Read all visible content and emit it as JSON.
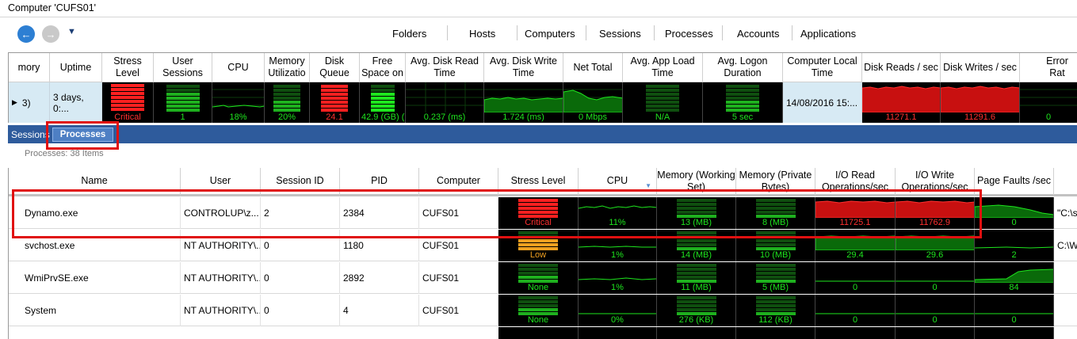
{
  "window": {
    "title": "Computer 'CUFS01'"
  },
  "nav": {
    "links": [
      "Folders",
      "Hosts",
      "Computers",
      "Sessions",
      "Processes",
      "Accounts",
      "Applications"
    ]
  },
  "summary": {
    "headers": [
      "mory",
      "Uptime",
      "Stress Level",
      "User Sessions",
      "CPU",
      "Memory Utilizatio",
      "Disk Queue",
      "Free Space on",
      "Avg. Disk Read Time",
      "Avg. Disk Write Time",
      "Net Total",
      "Avg. App Load Time",
      "Avg. Logon Duration",
      "Computer Local Time",
      "Disk Reads / sec",
      "Disk Writes / sec",
      "Error Rat"
    ],
    "first_cell": "3)",
    "uptime": "3 days, 0:...",
    "stress": "Critical",
    "user_sessions": "1",
    "cpu": "18%",
    "memory": "20%",
    "disk_queue": "24.1",
    "free_space": "42.9 (GB) (",
    "avg_disk_read": "0.237 (ms)",
    "avg_disk_write": "1.724 (ms)",
    "net_total": "0 Mbps",
    "avg_app_load": "N/A",
    "avg_logon": "5 sec",
    "local_time": "14/08/2016 15:...",
    "disk_reads": "11271.1",
    "disk_writes": "11291.6",
    "error_rate": "0"
  },
  "tabs": {
    "sessions": "Sessions",
    "processes": "Processes"
  },
  "processes_count": "Processes: 38 Items",
  "columns": [
    "Name",
    "User",
    "Session ID",
    "PID",
    "Computer",
    "Stress Level",
    "CPU",
    "Memory (Working Set)",
    "Memory (Private Bytes)",
    "I/O Read Operations/sec",
    "I/O Write Operations/sec",
    "Page Faults /sec"
  ],
  "rows": [
    {
      "name": "Dynamo.exe",
      "user": "CONTROLUP\\z...",
      "session": "2",
      "pid": "2384",
      "computer": "CUFS01",
      "stress": "Critical",
      "cpu": "11%",
      "mem_ws": "13 (MB)",
      "mem_pb": "8 (MB)",
      "io_read": "11725.1",
      "io_write": "11762.9",
      "page_faults": "0",
      "extra": "\"C:\\s"
    },
    {
      "name": "svchost.exe",
      "user": "NT AUTHORITY\\...",
      "session": "0",
      "pid": "1180",
      "computer": "CUFS01",
      "stress": "Low",
      "cpu": "1%",
      "mem_ws": "14 (MB)",
      "mem_pb": "10 (MB)",
      "io_read": "29.4",
      "io_write": "29.6",
      "page_faults": "2",
      "extra": "C:\\W"
    },
    {
      "name": "WmiPrvSE.exe",
      "user": "NT AUTHORITY\\...",
      "session": "0",
      "pid": "2892",
      "computer": "CUFS01",
      "stress": "None",
      "cpu": "1%",
      "mem_ws": "11 (MB)",
      "mem_pb": "5 (MB)",
      "io_read": "0",
      "io_write": "0",
      "page_faults": "84",
      "extra": ""
    },
    {
      "name": "System",
      "user": "NT AUTHORITY\\...",
      "session": "0",
      "pid": "4",
      "computer": "CUFS01",
      "stress": "None",
      "cpu": "0%",
      "mem_ws": "276 (KB)",
      "mem_pb": "112 (KB)",
      "io_read": "0",
      "io_write": "0",
      "page_faults": "0",
      "extra": ""
    }
  ],
  "colors": {
    "critical": "#ff2020",
    "low": "#f0a020",
    "none": "#1ee61e",
    "tab_strip": "#2e5b9c",
    "highlight": "#e01010"
  }
}
